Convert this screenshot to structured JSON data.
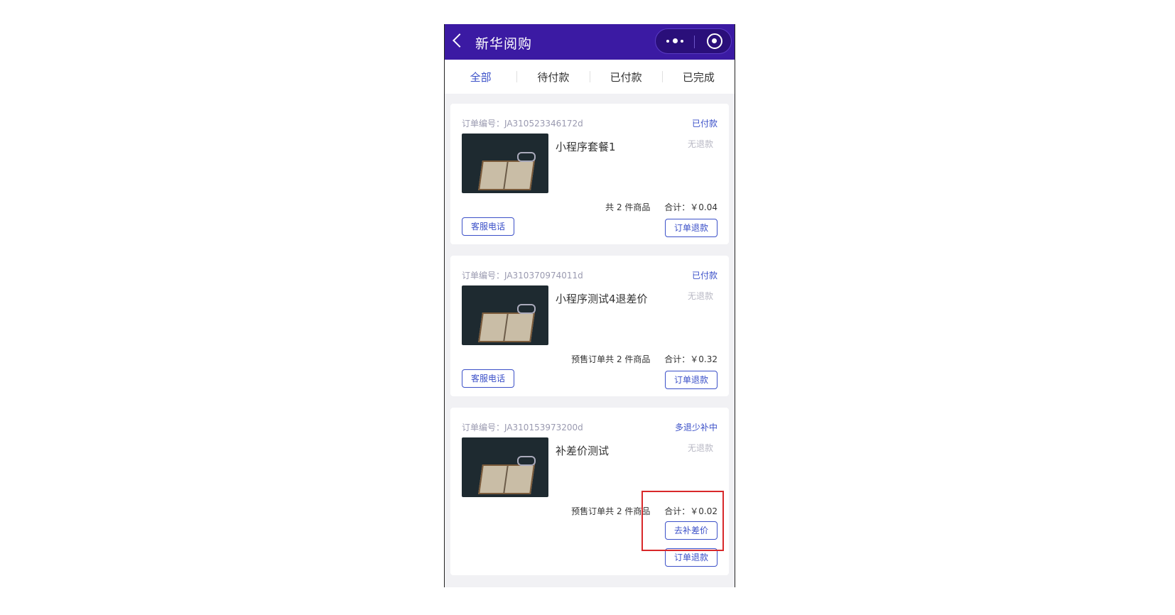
{
  "navbar": {
    "title": "新华阅购",
    "back_icon": "chevron-left-icon",
    "more_icon": "more-dots-icon",
    "target_icon": "record-target-icon"
  },
  "tabs": [
    {
      "label": "全部",
      "active": true
    },
    {
      "label": "待付款",
      "active": false
    },
    {
      "label": "已付款",
      "active": false
    },
    {
      "label": "已完成",
      "active": false
    }
  ],
  "orders": [
    {
      "order_no": "订单编号：JA310523346172d",
      "status": "已付款",
      "product_name": "小程序套餐1",
      "refund_tag": "无退款",
      "count_text": "共 2 件商品",
      "total_text": "合计：￥0.04",
      "left_button": "客服电话",
      "right_button": "订单退款"
    },
    {
      "order_no": "订单编号：JA310370974011d",
      "status": "已付款",
      "product_name": "小程序测试4退差价",
      "refund_tag": "无退款",
      "count_text": "预售订单共 2 件商品",
      "total_text": "合计：￥0.32",
      "left_button": "客服电话",
      "right_button": "订单退款"
    },
    {
      "order_no": "订单编号：JA310153973200d",
      "status": "多退少补中",
      "product_name": "补差价测试",
      "refund_tag": "无退款",
      "count_text": "预售订单共 2 件商品",
      "total_text": "合计：￥0.02",
      "button_pay_diff": "去补差价",
      "right_button": "订单退款"
    }
  ],
  "colors": {
    "navbar_bg": "#3b1aa3",
    "accent": "#3b50c8",
    "highlight_box": "#d8282a"
  }
}
